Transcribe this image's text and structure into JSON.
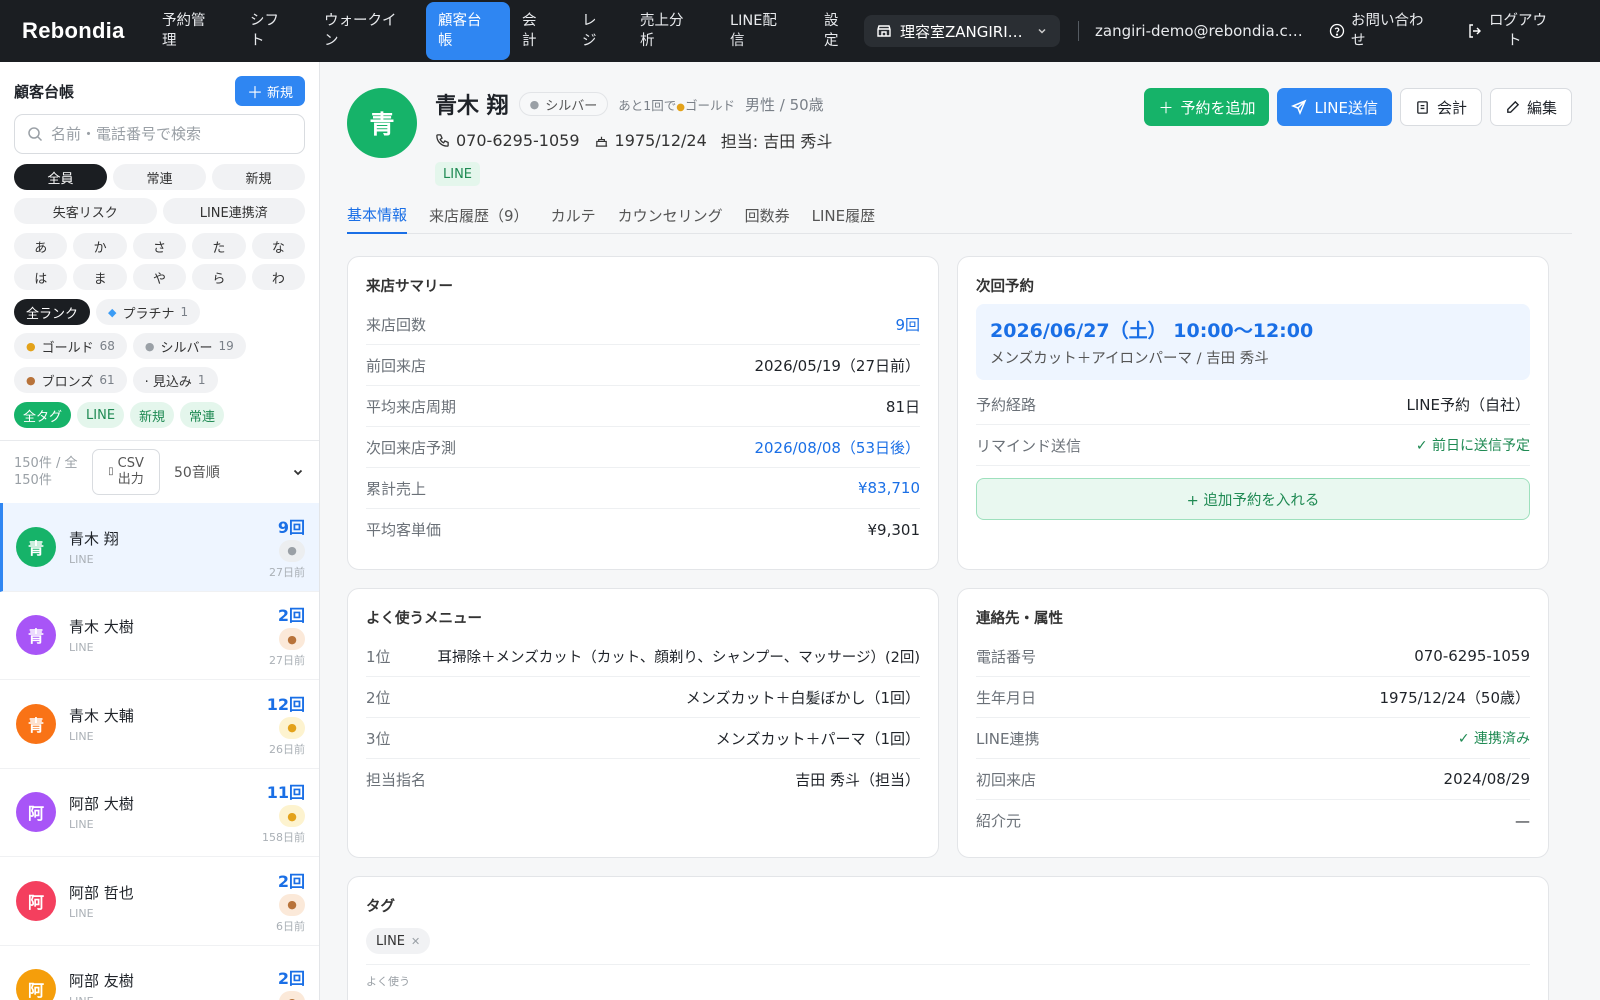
{
  "app": {
    "brand": "Rebondia"
  },
  "nav": {
    "items": [
      {
        "l1": "予約管",
        "l2": "理"
      },
      {
        "l1": "シフ",
        "l2": "ト"
      },
      {
        "l1": "ウォークイ",
        "l2": "ン"
      },
      {
        "l1": "顧客台",
        "l2": "帳"
      },
      {
        "l1": "会",
        "l2": "計"
      },
      {
        "l1": "レ",
        "l2": "ジ"
      },
      {
        "l1": "売上分",
        "l2": "析"
      },
      {
        "l1": "LINE配",
        "l2": "信"
      },
      {
        "l1": "設",
        "l2": "定"
      }
    ],
    "store": "理容室ZANGIRI（デモ）",
    "email": "zangiri-demo@rebondia.com",
    "contact": {
      "l1": "お問い合わ",
      "l2": "せ"
    },
    "logout": {
      "l1": "ログアウ",
      "l2": "ト"
    }
  },
  "sidebar": {
    "title": "顧客台帳",
    "new_label": "新規",
    "search_placeholder": "名前・電話番号で検索",
    "filters_row1": [
      "全員",
      "常連",
      "新規"
    ],
    "filters_row2": [
      "失客リスク",
      "LINE連携済"
    ],
    "kana_row1": [
      "あ",
      "か",
      "さ",
      "た",
      "な"
    ],
    "kana_row2": [
      "は",
      "ま",
      "や",
      "ら",
      "わ"
    ],
    "ranks": {
      "all": "全ランク",
      "platinum": {
        "label": "プラチナ",
        "count": "1"
      },
      "gold": {
        "label": "ゴールド",
        "count": "68"
      },
      "silver": {
        "label": "シルバー",
        "count": "19"
      },
      "bronze": {
        "label": "ブロンズ",
        "count": "61"
      },
      "prospect": {
        "label": "· 見込み",
        "count": "1"
      }
    },
    "tags": [
      "全タグ",
      "LINE",
      "新規",
      "常連"
    ],
    "count_l1": "150件 / 全",
    "count_l2": "150件",
    "csv_l1": "CSV",
    "csv_l2": "出力",
    "sort": "50音順",
    "customers": [
      {
        "initial": "青",
        "name": "青木 翔",
        "src": "LINE",
        "visits": "9回",
        "ago": "27日前",
        "color": "#16b369",
        "rank": "silver"
      },
      {
        "initial": "青",
        "name": "青木 大樹",
        "src": "LINE",
        "visits": "2回",
        "ago": "27日前",
        "color": "#a855f7",
        "rank": "bronze"
      },
      {
        "initial": "青",
        "name": "青木 大輔",
        "src": "LINE",
        "visits": "12回",
        "ago": "26日前",
        "color": "#f97316",
        "rank": "gold"
      },
      {
        "initial": "阿",
        "name": "阿部 大樹",
        "src": "LINE",
        "visits": "11回",
        "ago": "158日前",
        "color": "#a855f7",
        "rank": "gold"
      },
      {
        "initial": "阿",
        "name": "阿部 哲也",
        "src": "LINE",
        "visits": "2回",
        "ago": "6日前",
        "color": "#f43f5e",
        "rank": "bronze"
      },
      {
        "initial": "阿",
        "name": "阿部 友樹",
        "src": "LINE",
        "visits": "2回",
        "ago": "",
        "color": "#f59e0b",
        "rank": "bronze"
      }
    ]
  },
  "profile": {
    "initial": "青",
    "name": "青木 翔",
    "rank": "シルバー",
    "next_rank_l1": "あと1回で",
    "next_rank_l2": "ゴールド",
    "gender_age": "男性 / 50歳",
    "phone": "070-6295-1059",
    "birthday": "1975/12/24",
    "staff": "担当: 吉田 秀斗",
    "tag": "LINE"
  },
  "actions": {
    "add_reservation": "予約を追加",
    "line_send": "LINE送信",
    "checkout": "会計",
    "edit": "編集"
  },
  "tabs": [
    "基本情報",
    "来店履歴（9）",
    "カルテ",
    "カウンセリング",
    "回数券",
    "LINE履歴"
  ],
  "summary": {
    "title": "来店サマリー",
    "rows": [
      {
        "k": "来店回数",
        "v": "9回"
      },
      {
        "k": "前回来店",
        "v": "2026/05/19（27日前）"
      },
      {
        "k": "平均来店周期",
        "v": "81日"
      },
      {
        "k": "次回来店予測",
        "v": "2026/08/08（53日後）"
      },
      {
        "k": "累計売上",
        "v": "¥83,710"
      },
      {
        "k": "平均客単価",
        "v": "¥9,301"
      }
    ]
  },
  "next": {
    "title": "次回予約",
    "date": "2026/06/27（土） 10:00〜12:00",
    "detail": "メンズカット＋アイロンパーマ / 吉田 秀斗",
    "rows": [
      {
        "k": "予約経路",
        "v": "LINE予約（自社）"
      },
      {
        "k": "リマインド送信",
        "v": "✓ 前日に送信予定"
      }
    ],
    "add_label": "+ 追加予約を入れる"
  },
  "menu": {
    "title": "よく使うメニュー",
    "rows": [
      {
        "k": "1位",
        "v": "耳掃除＋メンズカット（カット、顔剃り、シャンプー、マッサージ）(2回)"
      },
      {
        "k": "2位",
        "v": "メンズカット＋白髪ぼかし（1回）"
      },
      {
        "k": "3位",
        "v": "メンズカット＋パーマ（1回）"
      },
      {
        "k": "担当指名",
        "v": "吉田 秀斗（担当）"
      }
    ]
  },
  "contact": {
    "title": "連絡先・属性",
    "rows": [
      {
        "k": "電話番号",
        "v": "070-6295-1059"
      },
      {
        "k": "生年月日",
        "v": "1975/12/24（50歳）"
      },
      {
        "k": "LINE連携",
        "v": "✓ 連携済み"
      },
      {
        "k": "初回来店",
        "v": "2024/08/29"
      },
      {
        "k": "紹介元",
        "v": "—"
      }
    ]
  },
  "tags_card": {
    "title": "タグ",
    "tag": "LINE",
    "sub": "よく使う"
  }
}
